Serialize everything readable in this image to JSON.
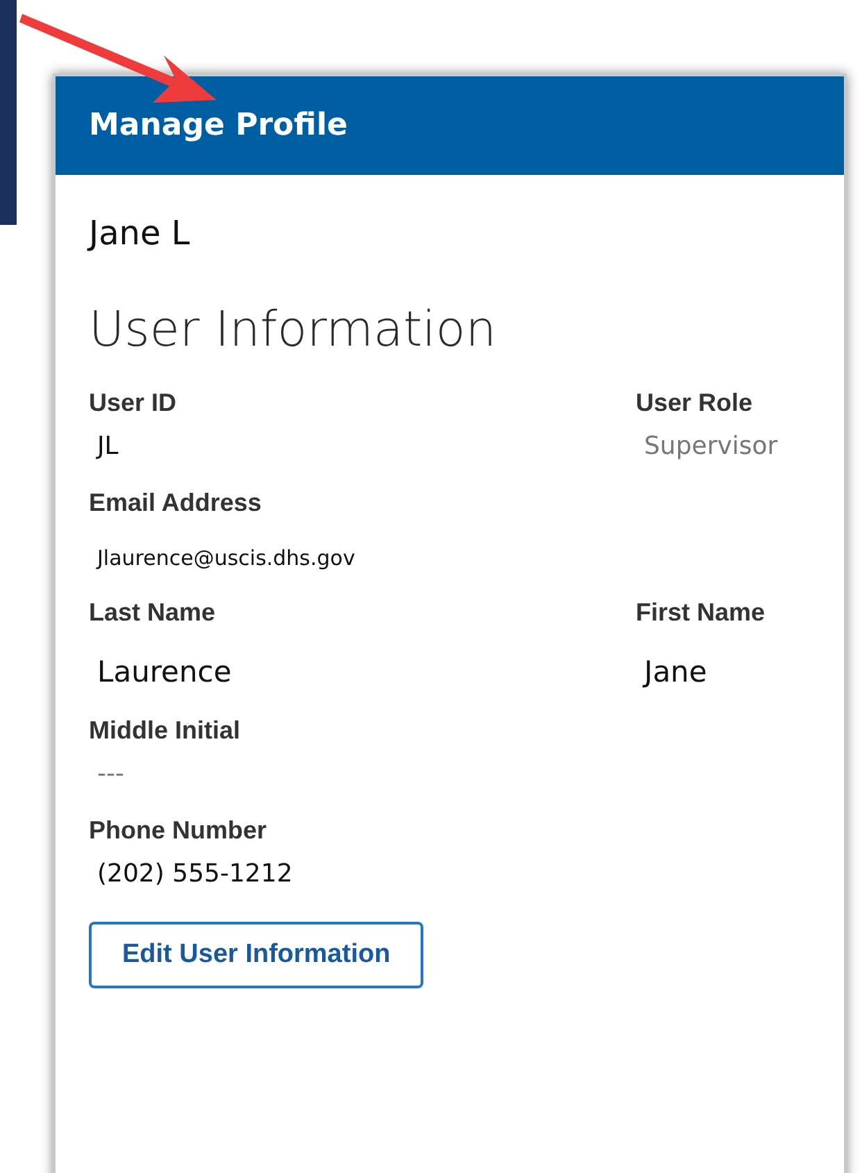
{
  "card": {
    "title": "Manage Profile",
    "user_name": "Jane L",
    "section_title": "User Information",
    "rows": [
      [
        {
          "label": "User ID",
          "value": "JL",
          "kind": "plain"
        },
        {
          "label": "User Role",
          "value": "Supervisor",
          "kind": "muted"
        }
      ],
      [
        {
          "label": "Email Address",
          "value": "Jlaurence@uscis.dhs.gov",
          "kind": "small"
        }
      ],
      [
        {
          "label": "Last Name",
          "value": "Laurence",
          "kind": "large"
        },
        {
          "label": "First Name",
          "value": "Jane",
          "kind": "large"
        }
      ],
      [
        {
          "label": "Middle Initial",
          "value": "---",
          "kind": "muted"
        }
      ],
      [
        {
          "label": "Phone Number",
          "value": "(202) 555-1212",
          "kind": "plain"
        }
      ]
    ],
    "button": "Edit User Information"
  }
}
